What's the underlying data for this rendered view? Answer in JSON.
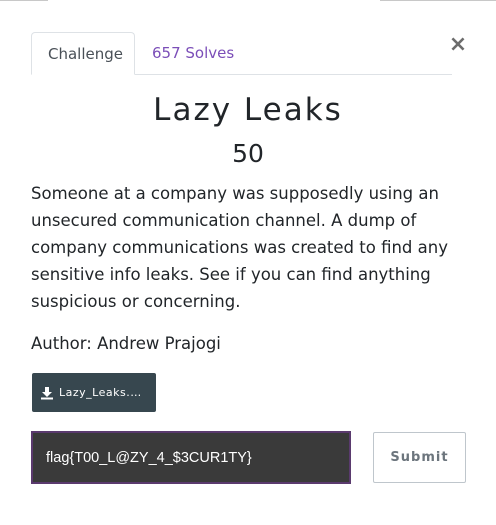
{
  "modal": {
    "close_symbol": "×",
    "tabs": [
      {
        "label": "Challenge"
      },
      {
        "label": "657 Solves"
      }
    ],
    "title": "Lazy Leaks",
    "value": "50",
    "description": "Someone at a company was supposedly using an unsecured communication channel. A dump of company communications was created to find any sensitive info leaks. See if you can find anything suspicious or concerning.",
    "author": "Author: Andrew Prajogi",
    "file": {
      "label": "Lazy_Leaks.pcapng",
      "icon": "download-icon"
    },
    "flag_input": {
      "value": "flag{T00_L@ZY_4_$3CUR1TY}",
      "placeholder": "Flag"
    },
    "submit_label": "Submit"
  },
  "colors": {
    "tab_active_text": "#495057",
    "tab_link": "#7b4eb8",
    "file_button_bg": "#37474f",
    "input_bg": "#3a3a3a",
    "input_border": "#5a3a6e"
  }
}
